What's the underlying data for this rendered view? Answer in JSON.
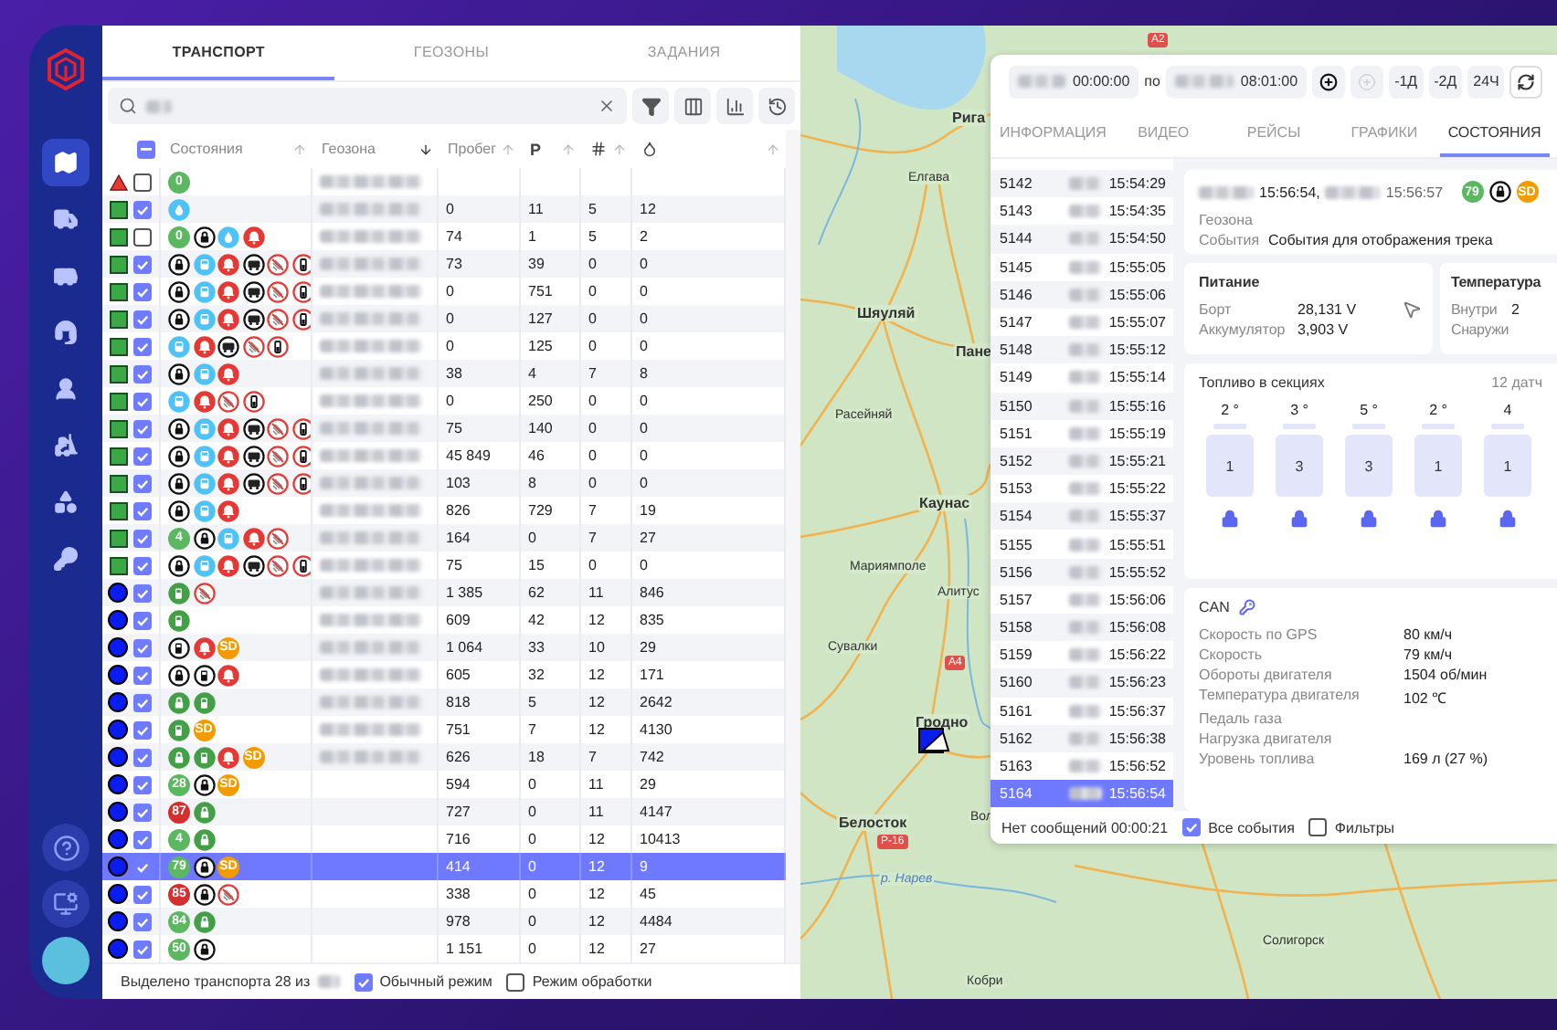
{
  "sidebar": {
    "items": [
      {
        "kind": "map",
        "selected": true
      },
      {
        "kind": "truck",
        "selected": false
      },
      {
        "kind": "van",
        "selected": false
      },
      {
        "kind": "operator",
        "selected": false
      },
      {
        "kind": "driver",
        "selected": false
      },
      {
        "kind": "loader",
        "selected": false
      },
      {
        "kind": "shapes",
        "selected": false
      },
      {
        "kind": "key",
        "selected": false
      }
    ],
    "bottom": [
      {
        "kind": "help"
      },
      {
        "kind": "monitor"
      },
      {
        "kind": "avatar"
      }
    ]
  },
  "tabs": [
    {
      "label": "ТРАНСПОРТ",
      "selected": true
    },
    {
      "label": "ГЕОЗОНЫ",
      "selected": false
    },
    {
      "label": "ЗАДАНИЯ",
      "selected": false
    }
  ],
  "search": {
    "value_blurred": true,
    "tools": [
      {
        "kind": "filter"
      },
      {
        "kind": "columns"
      },
      {
        "kind": "chart"
      },
      {
        "kind": "history"
      }
    ]
  },
  "vehicles": {
    "header_checkbox_partial": true,
    "columns": [
      {
        "label": "Состояния",
        "descending": false,
        "active": false
      },
      {
        "label": "Геозона",
        "descending": true,
        "active": true
      },
      {
        "label": "Пробег",
        "descending": false,
        "active": false
      },
      {
        "label": "Р",
        "descending": false,
        "active": false
      },
      {
        "descending": false,
        "active": false
      },
      {
        "descending": false,
        "active": false
      }
    ],
    "rows": [
      {
        "kind": "triangle",
        "checked": false,
        "selected": false,
        "geozone_blurred": true,
        "states": [
          {
            "kind": "badge",
            "text": "0",
            "color": "#5cb860"
          }
        ]
      },
      {
        "kind": "square",
        "checked": true,
        "selected": false,
        "geozone_blurred": true,
        "states": [
          {
            "kind": "drop"
          }
        ],
        "mileage": "0",
        "p": "11",
        "column_6": "5",
        "column_7": "12"
      },
      {
        "kind": "square",
        "checked": false,
        "selected": false,
        "geozone_blurred": true,
        "states": [
          {
            "kind": "badge",
            "text": "0",
            "color": "#5cb860"
          },
          {
            "kind": "lock"
          },
          {
            "kind": "drop"
          },
          {
            "kind": "bell"
          }
        ],
        "mileage": "74",
        "p": "1",
        "column_6": "5",
        "column_7": "2"
      },
      {
        "kind": "square",
        "checked": true,
        "selected": false,
        "geozone_blurred": true,
        "states": [
          {
            "kind": "lock"
          },
          {
            "kind": "bus"
          },
          {
            "kind": "bell"
          },
          {
            "kind": "truck"
          },
          {
            "kind": "no-signal"
          },
          {
            "kind": "battery"
          }
        ],
        "mileage": "73",
        "p": "39",
        "column_6": "0",
        "column_7": "0"
      },
      {
        "kind": "square",
        "checked": true,
        "selected": false,
        "geozone_blurred": true,
        "states": [
          {
            "kind": "lock"
          },
          {
            "kind": "bus"
          },
          {
            "kind": "bell"
          },
          {
            "kind": "truck"
          },
          {
            "kind": "no-signal"
          },
          {
            "kind": "battery"
          }
        ],
        "mileage": "0",
        "p": "751",
        "column_6": "0",
        "column_7": "0"
      },
      {
        "kind": "square",
        "checked": true,
        "selected": false,
        "geozone_blurred": true,
        "states": [
          {
            "kind": "lock"
          },
          {
            "kind": "bus"
          },
          {
            "kind": "bell"
          },
          {
            "kind": "truck"
          },
          {
            "kind": "no-signal"
          },
          {
            "kind": "battery"
          }
        ],
        "mileage": "0",
        "p": "127",
        "column_6": "0",
        "column_7": "0"
      },
      {
        "kind": "square",
        "checked": true,
        "selected": false,
        "geozone_blurred": true,
        "states": [
          {
            "kind": "bus"
          },
          {
            "kind": "bell"
          },
          {
            "kind": "truck"
          },
          {
            "kind": "no-signal"
          },
          {
            "kind": "battery"
          }
        ],
        "mileage": "0",
        "p": "125",
        "column_6": "0",
        "column_7": "0"
      },
      {
        "kind": "square",
        "checked": true,
        "selected": false,
        "geozone_blurred": true,
        "states": [
          {
            "kind": "lock"
          },
          {
            "kind": "bus"
          },
          {
            "kind": "bell"
          }
        ],
        "mileage": "38",
        "p": "4",
        "column_6": "7",
        "column_7": "8"
      },
      {
        "kind": "square",
        "checked": true,
        "selected": false,
        "geozone_blurred": true,
        "states": [
          {
            "kind": "bus"
          },
          {
            "kind": "bell"
          },
          {
            "kind": "no-signal"
          },
          {
            "kind": "battery"
          }
        ],
        "mileage": "0",
        "p": "250",
        "column_6": "0",
        "column_7": "0"
      },
      {
        "kind": "square",
        "checked": true,
        "selected": false,
        "geozone_blurred": true,
        "states": [
          {
            "kind": "lock"
          },
          {
            "kind": "bus"
          },
          {
            "kind": "bell"
          },
          {
            "kind": "truck"
          },
          {
            "kind": "no-signal"
          },
          {
            "kind": "battery"
          }
        ],
        "mileage": "75",
        "p": "140",
        "column_6": "0",
        "column_7": "0"
      },
      {
        "kind": "square",
        "checked": true,
        "selected": false,
        "geozone_blurred": true,
        "states": [
          {
            "kind": "lock"
          },
          {
            "kind": "bus"
          },
          {
            "kind": "bell"
          },
          {
            "kind": "truck"
          },
          {
            "kind": "no-signal"
          },
          {
            "kind": "battery"
          }
        ],
        "mileage": "45 849",
        "p": "46",
        "column_6": "0",
        "column_7": "0"
      },
      {
        "kind": "square",
        "checked": true,
        "selected": false,
        "geozone_blurred": true,
        "states": [
          {
            "kind": "lock"
          },
          {
            "kind": "bus"
          },
          {
            "kind": "bell"
          },
          {
            "kind": "truck"
          },
          {
            "kind": "no-signal"
          },
          {
            "kind": "battery"
          }
        ],
        "mileage": "103",
        "p": "8",
        "column_6": "0",
        "column_7": "0"
      },
      {
        "kind": "square",
        "checked": true,
        "selected": false,
        "geozone_blurred": true,
        "states": [
          {
            "kind": "lock"
          },
          {
            "kind": "bus"
          },
          {
            "kind": "bell"
          }
        ],
        "mileage": "826",
        "p": "729",
        "column_6": "7",
        "column_7": "19"
      },
      {
        "kind": "square",
        "checked": true,
        "selected": false,
        "geozone_blurred": true,
        "states": [
          {
            "kind": "badge",
            "text": "4",
            "color": "#5cb860"
          },
          {
            "kind": "lock"
          },
          {
            "kind": "bus"
          },
          {
            "kind": "bell"
          },
          {
            "kind": "no-signal"
          }
        ],
        "mileage": "164",
        "p": "0",
        "column_6": "7",
        "column_7": "27"
      },
      {
        "kind": "square",
        "checked": true,
        "selected": false,
        "geozone_blurred": true,
        "states": [
          {
            "kind": "lock"
          },
          {
            "kind": "bus"
          },
          {
            "kind": "bell"
          },
          {
            "kind": "truck"
          },
          {
            "kind": "no-signal"
          },
          {
            "kind": "battery"
          }
        ],
        "mileage": "75",
        "p": "15",
        "column_6": "0",
        "column_7": "0"
      },
      {
        "kind": "circle",
        "checked": true,
        "selected": false,
        "geozone_blurred": true,
        "states": [
          {
            "kind": "fuel"
          },
          {
            "kind": "no-signal"
          }
        ],
        "mileage": "1 385",
        "p": "62",
        "column_6": "11",
        "column_7": "846"
      },
      {
        "kind": "circle",
        "checked": true,
        "selected": false,
        "geozone_blurred": true,
        "states": [
          {
            "kind": "fuel"
          }
        ],
        "mileage": "609",
        "p": "42",
        "column_6": "12",
        "column_7": "835"
      },
      {
        "kind": "circle",
        "checked": true,
        "selected": false,
        "geozone_blurred": true,
        "states": [
          {
            "kind": "fuel-dark"
          },
          {
            "kind": "bell"
          },
          {
            "kind": "badge",
            "text": "SD",
            "color": "#f29b00"
          }
        ],
        "mileage": "1 064",
        "p": "33",
        "column_6": "10",
        "column_7": "29"
      },
      {
        "kind": "circle",
        "checked": true,
        "selected": false,
        "geozone_blurred": true,
        "states": [
          {
            "kind": "lock"
          },
          {
            "kind": "fuel-dark"
          },
          {
            "kind": "bell"
          }
        ],
        "mileage": "605",
        "p": "32",
        "column_6": "12",
        "column_7": "171"
      },
      {
        "kind": "circle",
        "checked": true,
        "selected": false,
        "geozone_blurred": true,
        "states": [
          {
            "kind": "lock-green"
          },
          {
            "kind": "fuel"
          }
        ],
        "mileage": "818",
        "p": "5",
        "column_6": "12",
        "column_7": "2642"
      },
      {
        "kind": "circle",
        "checked": true,
        "selected": false,
        "geozone_blurred": true,
        "states": [
          {
            "kind": "fuel"
          },
          {
            "kind": "badge",
            "text": "SD",
            "color": "#f29b00"
          }
        ],
        "mileage": "751",
        "p": "7",
        "column_6": "12",
        "column_7": "4130"
      },
      {
        "kind": "circle",
        "checked": true,
        "selected": false,
        "geozone_blurred": true,
        "states": [
          {
            "kind": "lock-green"
          },
          {
            "kind": "fuel"
          },
          {
            "kind": "bell"
          },
          {
            "kind": "badge",
            "text": "SD",
            "color": "#f29b00"
          }
        ],
        "mileage": "626",
        "p": "18",
        "column_6": "7",
        "column_7": "742"
      },
      {
        "kind": "circle",
        "checked": true,
        "selected": false,
        "geozone_blurred": false,
        "states": [
          {
            "kind": "badge",
            "text": "28",
            "color": "#5cb860"
          },
          {
            "kind": "lock"
          },
          {
            "kind": "badge",
            "text": "SD",
            "color": "#f29b00"
          }
        ],
        "mileage": "594",
        "p": "0",
        "column_6": "11",
        "column_7": "29"
      },
      {
        "kind": "circle",
        "checked": true,
        "selected": false,
        "geozone_blurred": false,
        "states": [
          {
            "kind": "badge",
            "text": "87",
            "color": "#d32f2f"
          },
          {
            "kind": "lock-green"
          }
        ],
        "mileage": "727",
        "p": "0",
        "column_6": "11",
        "column_7": "4147"
      },
      {
        "kind": "circle",
        "checked": true,
        "selected": false,
        "geozone_blurred": false,
        "states": [
          {
            "kind": "badge",
            "text": "4",
            "color": "#5cb860"
          },
          {
            "kind": "lock-green"
          }
        ],
        "mileage": "716",
        "p": "0",
        "column_6": "12",
        "column_7": "10413"
      },
      {
        "kind": "circle",
        "checked": true,
        "selected": true,
        "geozone_blurred": false,
        "states": [
          {
            "kind": "badge",
            "text": "79",
            "color": "#5cb860"
          },
          {
            "kind": "lock"
          },
          {
            "kind": "badge",
            "text": "SD",
            "color": "#f29b00"
          }
        ],
        "mileage": "414",
        "p": "0",
        "column_6": "12",
        "column_7": "9"
      },
      {
        "kind": "circle",
        "checked": true,
        "selected": false,
        "geozone_blurred": false,
        "states": [
          {
            "kind": "badge",
            "text": "85",
            "color": "#d32f2f"
          },
          {
            "kind": "lock"
          },
          {
            "kind": "no-signal"
          }
        ],
        "mileage": "338",
        "p": "0",
        "column_6": "12",
        "column_7": "45"
      },
      {
        "kind": "circle",
        "checked": true,
        "selected": false,
        "geozone_blurred": false,
        "states": [
          {
            "kind": "badge",
            "text": "84",
            "color": "#5cb860"
          },
          {
            "kind": "lock-green"
          }
        ],
        "mileage": "978",
        "p": "0",
        "column_6": "12",
        "column_7": "4484"
      },
      {
        "kind": "circle",
        "checked": true,
        "selected": false,
        "geozone_blurred": false,
        "states": [
          {
            "kind": "badge",
            "text": "50",
            "color": "#5cb860"
          },
          {
            "kind": "lock"
          }
        ],
        "mileage": "1 151",
        "p": "0",
        "column_6": "12",
        "column_7": "27"
      }
    ]
  },
  "footer": {
    "selected_text": "Выделено транспорта 28 из",
    "count_blurred": true,
    "options": [
      {
        "label": "Обычный режим",
        "checked": true
      },
      {
        "label": "Режим обработки",
        "checked": false
      }
    ]
  },
  "map": {
    "labels": [
      {
        "text": "Рига",
        "kind": "city"
      },
      {
        "text": "Елгава",
        "kind": "town"
      },
      {
        "text": "Шяуляй",
        "kind": "city"
      },
      {
        "text": "Пане",
        "kind": "city"
      },
      {
        "text": "Расейняй",
        "kind": "town"
      },
      {
        "text": "Каунас",
        "kind": "city"
      },
      {
        "text": "Мариямполе",
        "kind": "town"
      },
      {
        "text": "Алитус",
        "kind": "town"
      },
      {
        "text": "Сувалки",
        "kind": "town"
      },
      {
        "text": "Гродно",
        "kind": "city"
      },
      {
        "text": "Белосток",
        "kind": "city"
      },
      {
        "text": "Вол",
        "kind": "town"
      },
      {
        "text": "р. Нарев",
        "kind": "river"
      },
      {
        "text": "Кобри",
        "kind": "town"
      },
      {
        "text": "Солигорск",
        "kind": "town"
      }
    ],
    "road_signs": [
      "A2",
      "A4",
      "P-16"
    ]
  },
  "track_panel": {
    "toolbar": {
      "from_time": "00:00:00",
      "separator": "по",
      "to_time": "08:01:00",
      "buttons": [
        {
          "kind": "add",
          "disabled": false
        },
        {
          "kind": "add",
          "disabled": true
        },
        {
          "kind": "text",
          "label": "-1Д"
        },
        {
          "kind": "text",
          "label": "-2Д"
        },
        {
          "kind": "text",
          "label": "24Ч"
        },
        {
          "kind": "refresh"
        }
      ]
    },
    "tabs": [
      {
        "label": "ИНФОРМАЦИЯ",
        "selected": false
      },
      {
        "label": "ВИДЕО",
        "selected": false
      },
      {
        "label": "РЕЙСЫ",
        "selected": false
      },
      {
        "label": "ГРАФИКИ",
        "selected": false
      },
      {
        "label": "СОСТОЯНИЯ",
        "selected": true
      }
    ],
    "events": [
      {
        "number": "5142",
        "time": "15:54:29",
        "selected": false
      },
      {
        "number": "5143",
        "time": "15:54:35",
        "selected": false
      },
      {
        "number": "5144",
        "time": "15:54:50",
        "selected": false
      },
      {
        "number": "5145",
        "time": "15:55:05",
        "selected": false
      },
      {
        "number": "5146",
        "time": "15:55:06",
        "selected": false
      },
      {
        "number": "5147",
        "time": "15:55:07",
        "selected": false
      },
      {
        "number": "5148",
        "time": "15:55:12",
        "selected": false
      },
      {
        "number": "5149",
        "time": "15:55:14",
        "selected": false
      },
      {
        "number": "5150",
        "time": "15:55:16",
        "selected": false
      },
      {
        "number": "5151",
        "time": "15:55:19",
        "selected": false
      },
      {
        "number": "5152",
        "time": "15:55:21",
        "selected": false
      },
      {
        "number": "5153",
        "time": "15:55:22",
        "selected": false
      },
      {
        "number": "5154",
        "time": "15:55:37",
        "selected": false
      },
      {
        "number": "5155",
        "time": "15:55:51",
        "selected": false
      },
      {
        "number": "5156",
        "time": "15:55:52",
        "selected": false
      },
      {
        "number": "5157",
        "time": "15:56:06",
        "selected": false
      },
      {
        "number": "5158",
        "time": "15:56:08",
        "selected": false
      },
      {
        "number": "5159",
        "time": "15:56:22",
        "selected": false
      },
      {
        "number": "5160",
        "time": "15:56:23",
        "selected": false
      },
      {
        "number": "5161",
        "time": "15:56:37",
        "selected": false
      },
      {
        "number": "5162",
        "time": "15:56:38",
        "selected": false
      },
      {
        "number": "5163",
        "time": "15:56:52",
        "selected": false
      },
      {
        "number": "5164",
        "time": "15:56:54",
        "selected": true
      }
    ],
    "footer": {
      "status": "Нет сообщений 00:00:21",
      "options": [
        {
          "label": "Все события",
          "checked": true
        },
        {
          "label": "Фильтры",
          "checked": false
        }
      ]
    },
    "summary": {
      "start_time": "15:56:54,",
      "end_time": "15:56:57",
      "states": [
        {
          "kind": "badge",
          "text": "79",
          "color": "#5cb860"
        },
        {
          "kind": "lock"
        },
        {
          "kind": "badge",
          "text": "SD",
          "color": "#f29b00"
        }
      ],
      "fields": [
        {
          "label": "Геозона"
        },
        {
          "label": "События",
          "value": "События для отображения трека"
        }
      ]
    },
    "power": {
      "title": "Питание",
      "rows": [
        {
          "label": "Борт",
          "value": "28,131 V"
        },
        {
          "label": "Аккумулятор",
          "value": "3,903 V"
        }
      ]
    },
    "temperature": {
      "title": "Температура",
      "rows": [
        {
          "label": "Внутри",
          "value": "2"
        },
        {
          "label": "Снаружи"
        }
      ]
    },
    "fuel": {
      "title": "Топливо в секциях",
      "sensors": "12 датч",
      "tanks": [
        {
          "temp": "2 °",
          "value": "1",
          "locked": true
        },
        {
          "temp": "3 °",
          "value": "3",
          "locked": true
        },
        {
          "temp": "5 °",
          "value": "3",
          "locked": true
        },
        {
          "temp": "2 °",
          "value": "1",
          "locked": true
        },
        {
          "temp": "4",
          "value": "1",
          "locked": true
        }
      ]
    },
    "can": {
      "title": "CAN",
      "rows": [
        {
          "label": "Скорость по GPS",
          "value": "80 км/ч"
        },
        {
          "label": "Скорость",
          "value": "79 км/ч"
        },
        {
          "label": "Обороты двигателя",
          "value": "1504 об/мин"
        },
        {
          "label": "Температура двигателя",
          "value": "102 ℃"
        },
        {
          "label": "Педаль газа"
        },
        {
          "label": "Нагрузка двигателя"
        },
        {
          "label": "Уровень топлива",
          "value": "169 л (27 %)"
        }
      ]
    }
  }
}
